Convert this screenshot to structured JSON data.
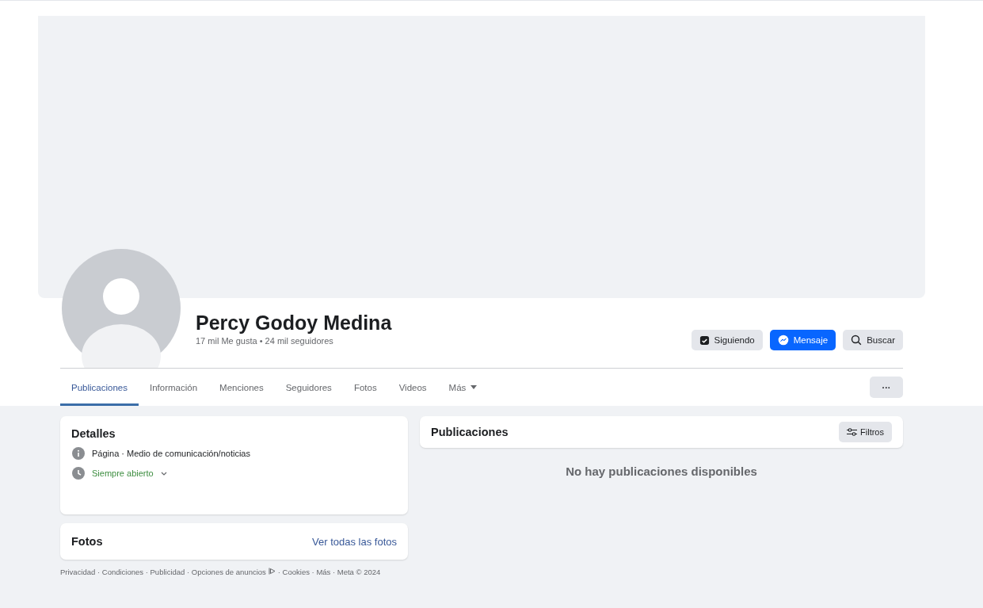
{
  "profile": {
    "name": "Percy Godoy Medina",
    "stats": "17 mil Me gusta • 24 mil seguidores"
  },
  "actions": [
    {
      "label": "Siguiendo",
      "kind": "following",
      "primary": false
    },
    {
      "label": "Mensaje",
      "kind": "message",
      "primary": true
    },
    {
      "label": "Buscar",
      "kind": "search",
      "primary": false
    }
  ],
  "tabs": [
    {
      "label": "Publicaciones",
      "selected": true,
      "kind": "tab"
    },
    {
      "label": "Información",
      "selected": false,
      "kind": "tab"
    },
    {
      "label": "Menciones",
      "selected": false,
      "kind": "tab"
    },
    {
      "label": "Seguidores",
      "selected": false,
      "kind": "tab"
    },
    {
      "label": "Fotos",
      "selected": false,
      "kind": "tab"
    },
    {
      "label": "Videos",
      "selected": false,
      "kind": "tab"
    },
    {
      "label": "Más",
      "selected": false,
      "kind": "menu"
    }
  ],
  "overflow_button": "···",
  "details": {
    "title": "Detalles",
    "items": [
      {
        "kind": "info",
        "text": "Página · Medio de comunicación/noticias"
      },
      {
        "kind": "hours",
        "text": "Siempre abierto"
      }
    ]
  },
  "photos": {
    "title": "Fotos",
    "link": "Ver todas las fotos"
  },
  "footer": {
    "before": "Privacidad · Condiciones · Publicidad · Opciones de anuncios",
    "after": "· Cookies · Más · Meta © 2024"
  },
  "posts": {
    "title": "Publicaciones",
    "filter": "Filtros",
    "empty": "No hay publicaciones disponibles"
  }
}
